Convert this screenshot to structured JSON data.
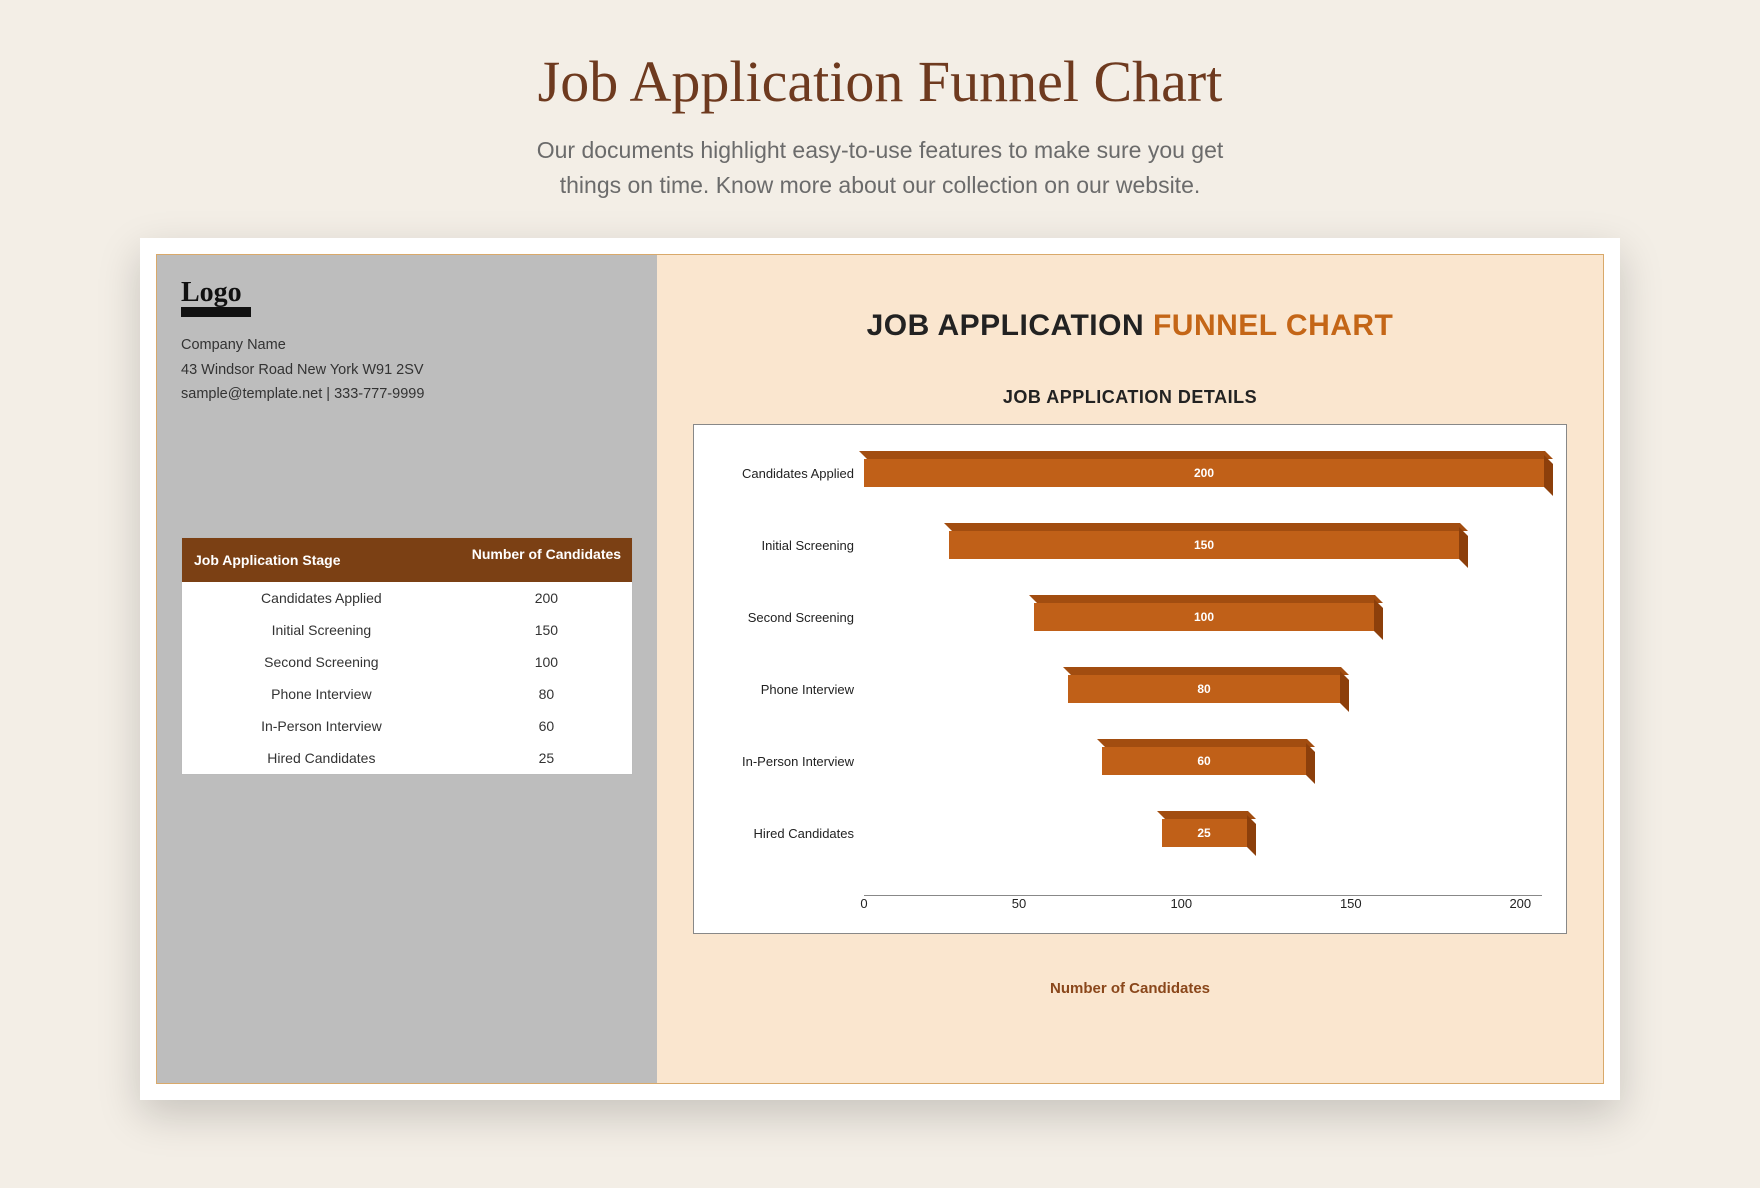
{
  "page": {
    "title": "Job Application Funnel Chart",
    "subtitle_line1": "Our documents highlight easy-to-use features to make sure you get",
    "subtitle_line2": "things on time. Know more about our collection on our website."
  },
  "company": {
    "logo_text": "Logo",
    "name": "Company Name",
    "address": "43 Windsor Road New York W91 2SV",
    "contact": "sample@template.net | 333-777-9999"
  },
  "table": {
    "col1": "Job Application Stage",
    "col2": "Number of Candidates",
    "rows": [
      {
        "stage": "Candidates Applied",
        "value": "200"
      },
      {
        "stage": "Initial Screening",
        "value": "150"
      },
      {
        "stage": "Second Screening",
        "value": "100"
      },
      {
        "stage": "Phone Interview",
        "value": "80"
      },
      {
        "stage": "In-Person Interview",
        "value": "60"
      },
      {
        "stage": "Hired Candidates",
        "value": "25"
      }
    ]
  },
  "chart": {
    "title_a": "JOB APPLICATION ",
    "title_b": "FUNNEL CHART",
    "subtitle": "JOB APPLICATION DETAILS",
    "x_title": "Number of Candidates",
    "ticks": [
      "0",
      "50",
      "100",
      "150",
      "200"
    ]
  },
  "chart_data": {
    "type": "bar",
    "orientation": "horizontal-funnel",
    "categories": [
      "Candidates Applied",
      "Initial Screening",
      "Second Screening",
      "Phone Interview",
      "In-Person Interview",
      "Hired Candidates"
    ],
    "values": [
      200,
      150,
      100,
      80,
      60,
      25
    ],
    "title": "JOB APPLICATION DETAILS",
    "xlabel": "Number of Candidates",
    "ylabel": "",
    "xlim": [
      0,
      200
    ]
  }
}
